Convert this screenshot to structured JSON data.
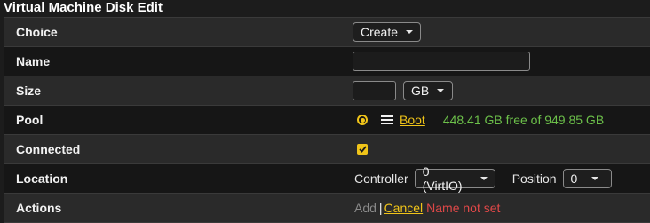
{
  "window": {
    "title": "Virtual Machine Disk Edit"
  },
  "rows": {
    "choice": {
      "label": "Choice",
      "value": "Create"
    },
    "name": {
      "label": "Name",
      "value": ""
    },
    "size": {
      "label": "Size",
      "value": "",
      "unit": "GB"
    },
    "pool": {
      "label": "Pool",
      "pool_name": "Boot",
      "free_text": "448.41 GB free of 949.85 GB"
    },
    "connected": {
      "label": "Connected",
      "checked": true
    },
    "location": {
      "label": "Location",
      "controller_label": "Controller",
      "controller_value": "0 (VirtIO)",
      "position_label": "Position",
      "position_value": "0"
    },
    "actions": {
      "label": "Actions",
      "add_label": "Add",
      "separator": "|",
      "cancel_label": "Cancel",
      "error_text": "Name not set"
    }
  },
  "colors": {
    "accent": "#f0c419",
    "success": "#6cc04a",
    "error": "#e04848"
  }
}
